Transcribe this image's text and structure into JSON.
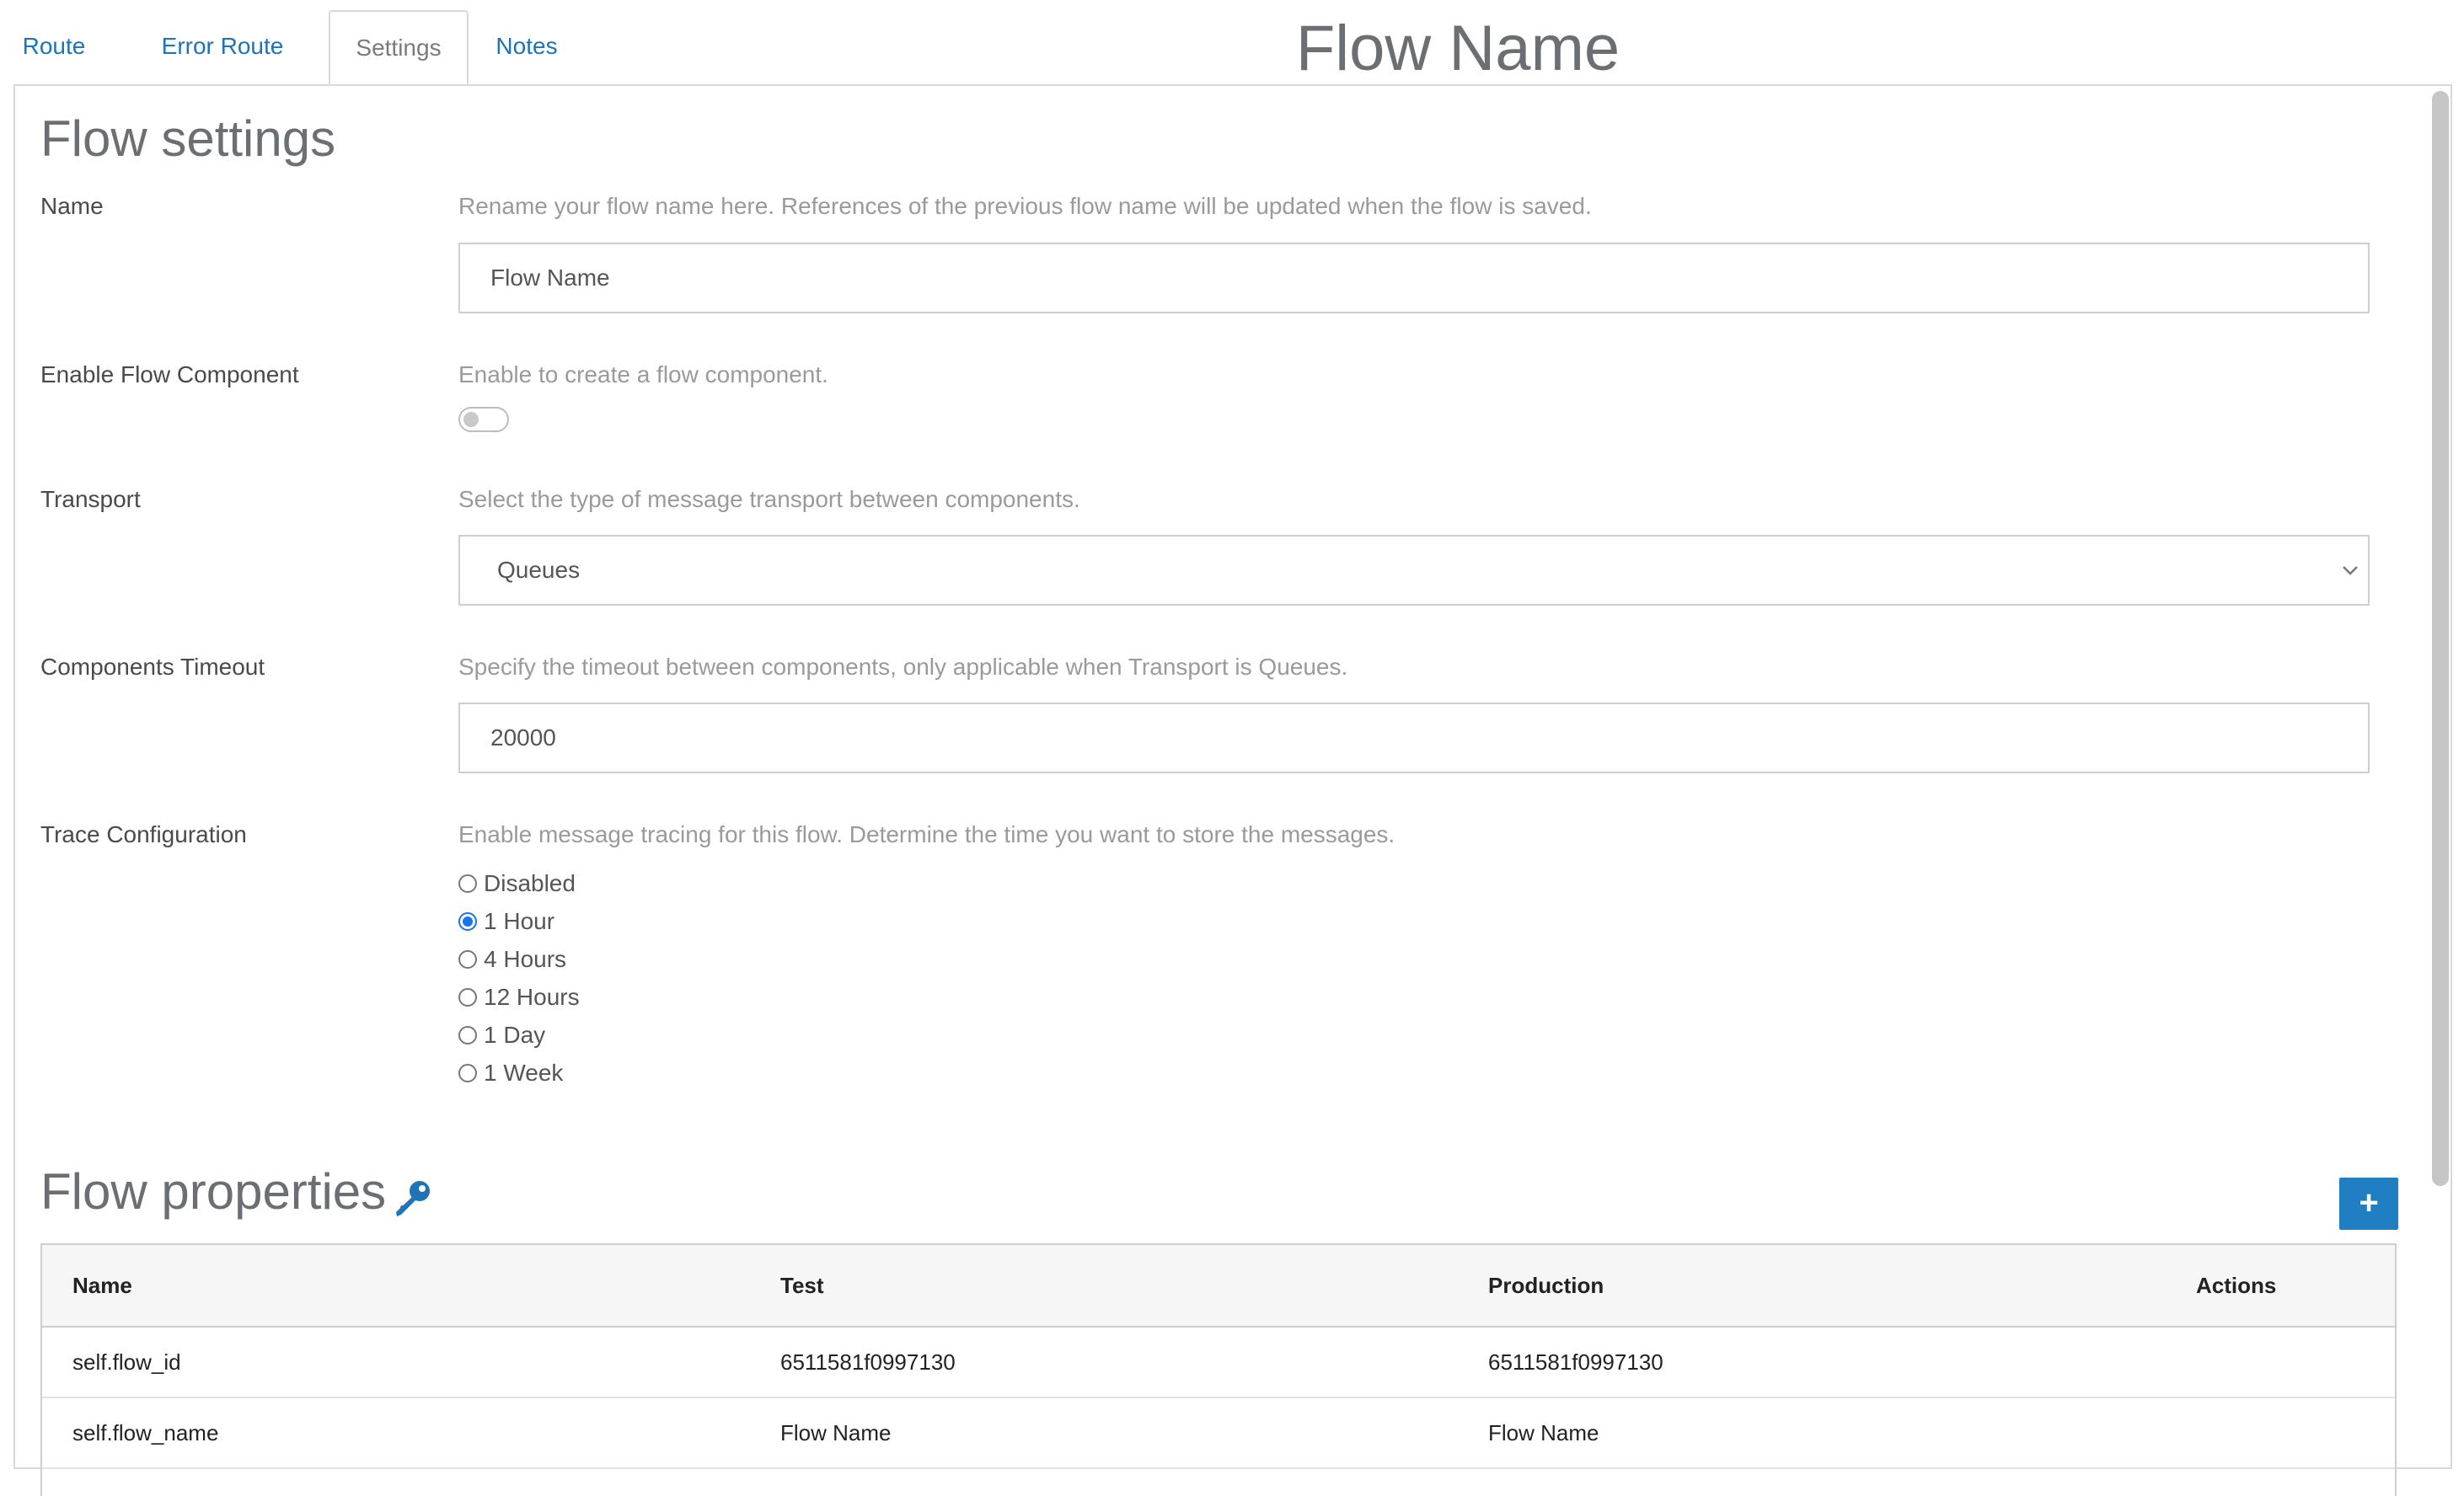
{
  "tabs": [
    {
      "label": "Route",
      "active": false
    },
    {
      "label": "Error Route",
      "active": false
    },
    {
      "label": "Settings",
      "active": true
    },
    {
      "label": "Notes",
      "active": false
    }
  ],
  "flow_title": "Flow Name",
  "settings": {
    "heading": "Flow settings",
    "name": {
      "label": "Name",
      "help": "Rename your flow name here. References of the previous flow name will be updated when the flow is saved.",
      "value": "Flow Name"
    },
    "flow_component": {
      "label": "Enable Flow Component",
      "help": "Enable to create a flow component.",
      "enabled": false
    },
    "transport": {
      "label": "Transport",
      "help": "Select the type of message transport between components.",
      "value": "Queues"
    },
    "timeout": {
      "label": "Components Timeout",
      "help": "Specify the timeout between components, only applicable when Transport is Queues.",
      "value": "20000"
    },
    "trace": {
      "label": "Trace Configuration",
      "help": "Enable message tracing for this flow. Determine the time you want to store the messages.",
      "options": [
        "Disabled",
        "1 Hour",
        "4 Hours",
        "12 Hours",
        "1 Day",
        "1 Week"
      ],
      "selected": "1 Hour"
    }
  },
  "properties": {
    "heading": "Flow properties",
    "add_label": "+",
    "columns": [
      "Name",
      "Test",
      "Production",
      "Actions"
    ],
    "rows": [
      {
        "name": "self.flow_id",
        "test": "6511581f0997130",
        "production": "6511581f0997130"
      },
      {
        "name": "self.flow_name",
        "test": "Flow Name",
        "production": "Flow Name"
      }
    ]
  },
  "colors": {
    "accent": "#1f73b7",
    "button": "#1f7fc2",
    "radio": "#1a73e8"
  }
}
